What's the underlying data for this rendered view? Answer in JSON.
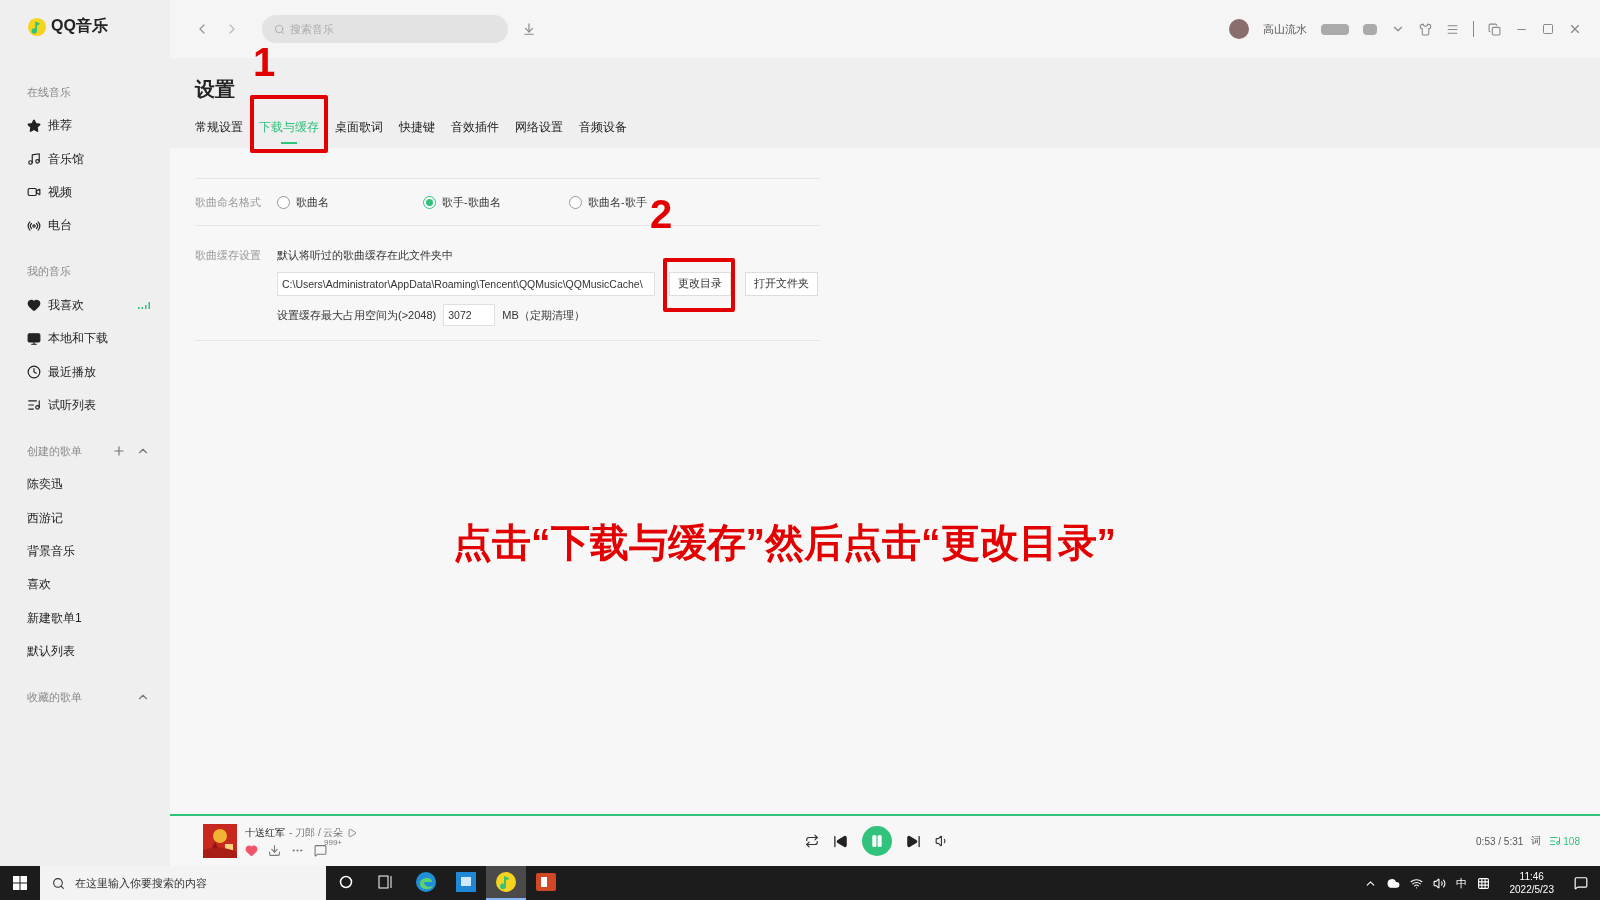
{
  "app": {
    "logo": "QQ音乐"
  },
  "sidebar": {
    "sections": [
      {
        "title": "在线音乐",
        "items": [
          {
            "label": "推荐",
            "kind": "star",
            "selected": false,
            "playing": false
          },
          {
            "label": "音乐馆",
            "kind": "music",
            "selected": false,
            "playing": false
          },
          {
            "label": "视频",
            "kind": "video",
            "selected": false,
            "playing": false
          },
          {
            "label": "电台",
            "kind": "radio",
            "selected": false,
            "playing": false
          }
        ]
      },
      {
        "title": "我的音乐",
        "items": [
          {
            "label": "我喜欢",
            "kind": "heart",
            "selected": false,
            "playing": true
          },
          {
            "label": "本地和下载",
            "kind": "monitor",
            "selected": false,
            "playing": false
          },
          {
            "label": "最近播放",
            "kind": "clock",
            "selected": false,
            "playing": false
          },
          {
            "label": "试听列表",
            "kind": "list",
            "selected": false,
            "playing": false
          }
        ]
      },
      {
        "title": "创建的歌单",
        "addable": true,
        "expanded": true,
        "items": [
          {
            "label": "陈奕迅",
            "kind": "plain",
            "selected": false,
            "playing": false
          },
          {
            "label": "西游记",
            "kind": "plain",
            "selected": false,
            "playing": false
          },
          {
            "label": "背景音乐",
            "kind": "plain",
            "selected": false,
            "playing": false
          },
          {
            "label": "喜欢",
            "kind": "plain",
            "selected": false,
            "playing": false
          },
          {
            "label": "新建歌单1",
            "kind": "plain",
            "selected": false,
            "playing": false
          },
          {
            "label": "默认列表",
            "kind": "plain",
            "selected": false,
            "playing": false
          }
        ]
      },
      {
        "title": "收藏的歌单",
        "expanded": true
      }
    ]
  },
  "topbar": {
    "search": {
      "placeholder": "搜索音乐"
    },
    "user": {
      "name": "高山流水"
    }
  },
  "settings": {
    "title": "设置",
    "tabs": [
      {
        "label": "常规设置",
        "selected": false
      },
      {
        "label": "下载与缓存",
        "selected": true,
        "callout": "1"
      },
      {
        "label": "桌面歌词",
        "selected": false
      },
      {
        "label": "快捷键",
        "selected": false
      },
      {
        "label": "音效插件",
        "selected": false
      },
      {
        "label": "网络设置",
        "selected": false
      },
      {
        "label": "音频设备",
        "selected": false
      }
    ],
    "naming": {
      "label": "歌曲命名格式",
      "options": [
        {
          "label": "歌曲名",
          "selected": false
        },
        {
          "label": "歌手-歌曲名",
          "selected": true
        },
        {
          "label": "歌曲名-歌手",
          "selected": false
        }
      ]
    },
    "cache": {
      "label": "歌曲缓存设置",
      "description": "默认将听过的歌曲缓存在此文件夹中",
      "path": "C:\\Users\\Administrator\\AppData\\Roaming\\Tencent\\QQMusic\\QQMusicCache\\",
      "buttons": [
        {
          "label": "更改目录",
          "callout": "2"
        },
        {
          "label": "打开文件夹"
        }
      ],
      "size_label": "设置缓存最大占用空间为(>2048)",
      "size_value": "3072",
      "size_unit": "MB（定期清理）"
    }
  },
  "caption": "点击“下载与缓存”然后点击“更改目录”",
  "player": {
    "title": "十送红军",
    "artists": "- 刀郎 / 云朵",
    "liked": true,
    "comments": "999+",
    "playing": true,
    "time": "0:53 / 5:31",
    "lyrics": "词",
    "queue": "108"
  },
  "taskbar": {
    "search": {
      "placeholder": "在这里输入你要搜索的内容"
    },
    "apps": [
      {
        "kind": "cortana",
        "selected": false
      },
      {
        "kind": "taskview",
        "selected": false
      },
      {
        "kind": "browser",
        "selected": false
      },
      {
        "kind": "store",
        "selected": false
      },
      {
        "kind": "music",
        "selected": true
      },
      {
        "kind": "slides",
        "selected": false
      }
    ],
    "ime": "中",
    "time": "11:46",
    "date": "2022/5/23"
  }
}
